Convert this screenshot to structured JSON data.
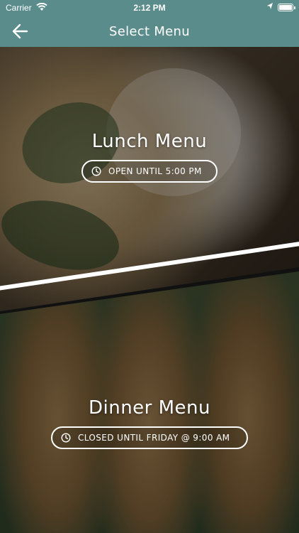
{
  "status": {
    "carrier": "Carrier",
    "time": "2:12 PM"
  },
  "nav": {
    "title": "Select Menu",
    "back_icon": "arrow-left-icon"
  },
  "menus": [
    {
      "title": "Lunch Menu",
      "status": "OPEN UNTIL 5:00 PM",
      "icon": "clock-icon"
    },
    {
      "title": "Dinner Menu",
      "status": "CLOSED UNTIL FRIDAY @ 9:00 AM",
      "icon": "clock-icon"
    }
  ],
  "colors": {
    "header": "#5b8c8c",
    "text": "#ffffff"
  }
}
